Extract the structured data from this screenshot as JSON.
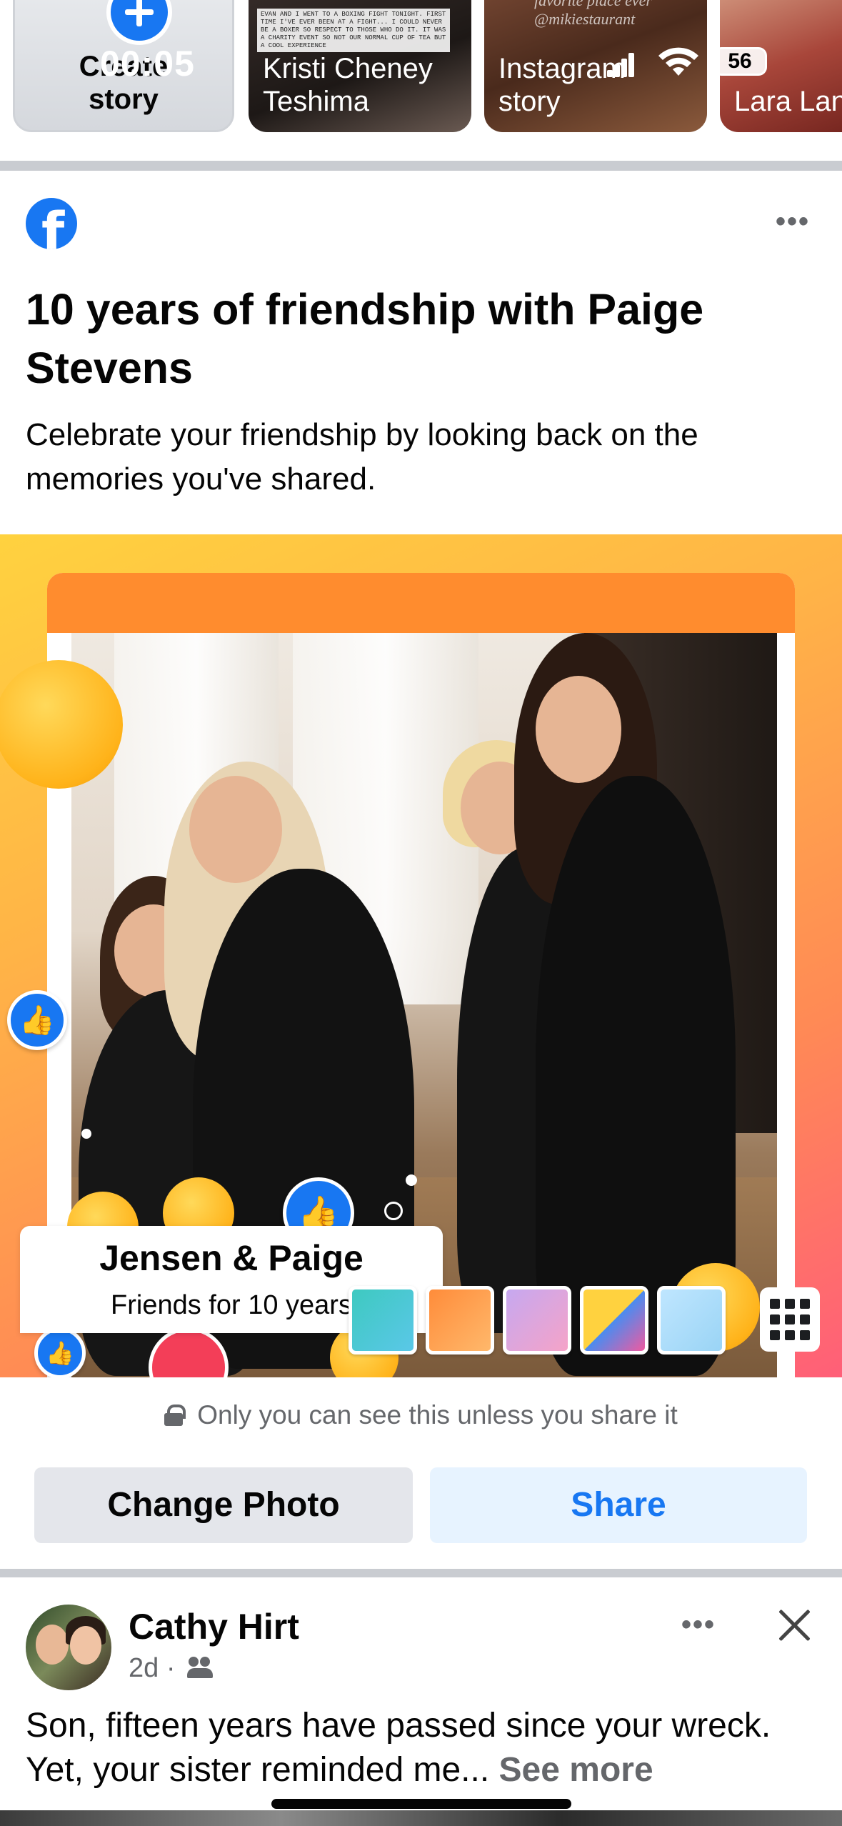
{
  "status_bar": {
    "time": "00:05",
    "battery": "56"
  },
  "stories": [
    {
      "label": "Create\nstory"
    },
    {
      "label": "Kristi Cheney\nTeshima",
      "note": "EVAN AND I WENT TO A BOXING FIGHT TONIGHT. FIRST TIME I'VE EVER BEEN AT A FIGHT... I COULD NEVER BE A BOXER SO RESPECT TO THOSE WHO DO IT. IT WAS A CHARITY EVENT SO NOT OUR NORMAL CUP OF TEA BUT A COOL EXPERIENCE"
    },
    {
      "label": "Instagram\nstory",
      "overlay": "favorite place ever\n@mikiestaurant"
    },
    {
      "label": "Lara Lan"
    }
  ],
  "memory": {
    "title": "10 years of friendship with Paige Stevens",
    "subtitle": "Celebrate your friendship by looking back on the memories you've shared.",
    "card_names": "Jensen & Paige",
    "card_years": "Friends for 10 years",
    "privacy": "Only you can see this unless you share it",
    "change_photo": "Change Photo",
    "share": "Share"
  },
  "post": {
    "author": "Cathy Hirt",
    "time": "2d",
    "text": "Son, fifteen years have passed since your wreck. Yet, your sister reminded me...",
    "see_more": "See more"
  },
  "colors": {
    "brand": "#1877f2",
    "secondary_text": "#65676b",
    "button_grey": "#e4e6eb",
    "button_blue_bg": "#e7f3ff"
  },
  "icons": [
    "plus-icon",
    "facebook-logo-icon",
    "more-icon",
    "lock-icon",
    "grid-icon",
    "friends-icon",
    "close-icon",
    "like-icon",
    "heart-icon",
    "care-emoji-icon"
  ]
}
